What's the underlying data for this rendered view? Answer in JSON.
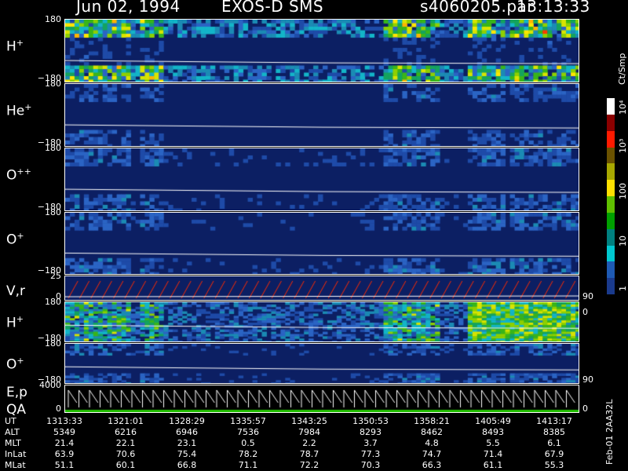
{
  "header": {
    "date": "Jun 02, 1994",
    "mission": "EXOS-D SMS",
    "file": "s4060205.par",
    "time": "13:13:33"
  },
  "colorbar": {
    "unit": "Ct/Smp",
    "labels": [
      "10⁴",
      "10³",
      "100",
      "10",
      "1"
    ],
    "colors": [
      "#ffffff",
      "#8b0000",
      "#ff1a00",
      "#6b5200",
      "#a8a800",
      "#ffe000",
      "#60c000",
      "#00a000",
      "#008080",
      "#00c8d0",
      "#1e5ab4",
      "#1a3a8c"
    ]
  },
  "side_label": "Feb-01 2AA32L",
  "panels": [
    {
      "id": "hplus1",
      "label": "H",
      "sup": "+",
      "ytop": "180",
      "ybot": "−180"
    },
    {
      "id": "heplus",
      "label": "He",
      "sup": "+",
      "ytop": "180",
      "ybot": "−180"
    },
    {
      "id": "oplusplus",
      "label": "O",
      "sup": "++",
      "ytop": "180",
      "ybot": "−180"
    },
    {
      "id": "oplus1",
      "label": "O",
      "sup": "+",
      "ytop": "180",
      "ybot": "−180"
    },
    {
      "id": "vr",
      "label": "V,r",
      "sup": "",
      "ytop": "25",
      "ybot": "0",
      "rtop": "90",
      "rbot": "0"
    },
    {
      "id": "hplus2",
      "label": "H",
      "sup": "+",
      "ytop": "180",
      "ybot": "−180"
    },
    {
      "id": "oplus2",
      "label": "O",
      "sup": "+",
      "ytop": "180",
      "ybot": "−180",
      "rtop": "90"
    },
    {
      "id": "ep",
      "label": "E,p",
      "sup": "",
      "label2": "QA",
      "ytop": "4000",
      "ybot": "0",
      "rbot": "0"
    }
  ],
  "orbit_table": {
    "rows": [
      {
        "label": "UT",
        "values": [
          "1313:33",
          "1321:01",
          "1328:29",
          "1335:57",
          "1343:25",
          "1350:53",
          "1358:21",
          "1405:49",
          "1413:17"
        ]
      },
      {
        "label": "ALT",
        "values": [
          "5349",
          "6216",
          "6946",
          "7536",
          "7984",
          "8293",
          "8462",
          "8493",
          "8385"
        ]
      },
      {
        "label": "MLT",
        "values": [
          "21.4",
          "22.1",
          "23.1",
          "0.5",
          "2.2",
          "3.7",
          "4.8",
          "5.5",
          "6.1"
        ]
      },
      {
        "label": "InLat",
        "values": [
          "63.9",
          "70.6",
          "75.4",
          "78.2",
          "78.7",
          "77.3",
          "74.7",
          "71.4",
          "67.9"
        ]
      },
      {
        "label": "MLat",
        "values": [
          "51.1",
          "60.1",
          "66.8",
          "71.1",
          "72.2",
          "70.3",
          "66.3",
          "61.1",
          "55.3"
        ]
      }
    ]
  },
  "chart_data": {
    "type": "heatmap",
    "title": "Jun 02, 1994   EXOS-D SMS",
    "x_ticks": [
      "1313:33",
      "1321:01",
      "1328:29",
      "1335:57",
      "1343:25",
      "1350:53",
      "1358:21",
      "1405:49",
      "1413:17"
    ],
    "colorbar_unit": "Ct/Smp",
    "colorbar_ticks": [
      "1",
      "10",
      "100",
      "10³",
      "10⁴"
    ],
    "panels": [
      "H+",
      "He+",
      "O++",
      "O+",
      "V,r",
      "H+",
      "O+",
      "E,p QA"
    ],
    "y_range_pitch": [
      -180,
      180
    ],
    "vr_range": [
      0,
      25
    ],
    "ep_range": [
      0,
      4000
    ]
  }
}
